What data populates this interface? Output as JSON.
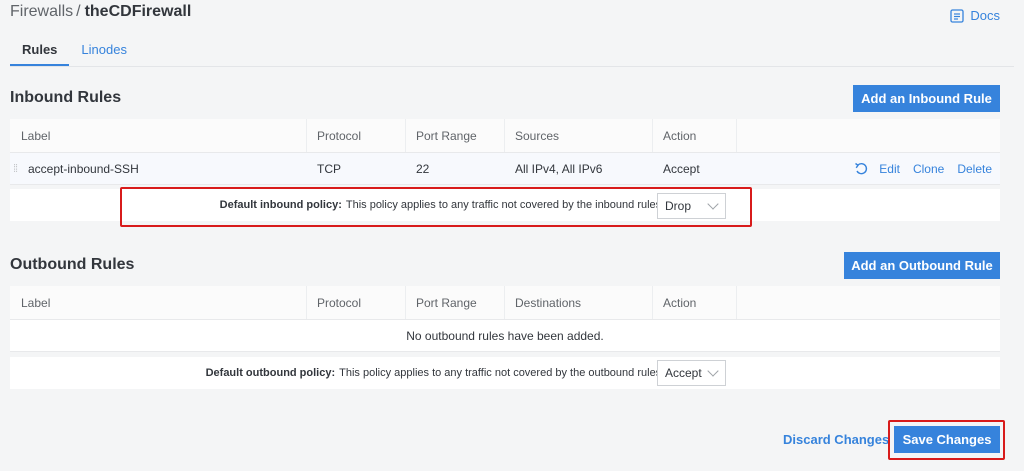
{
  "breadcrumb": {
    "parent": "Firewalls",
    "separator": "/",
    "current": "theCDFirewall"
  },
  "docs": {
    "label": "Docs",
    "icon": "docs-icon"
  },
  "tabs": [
    {
      "label": "Rules",
      "active": true
    },
    {
      "label": "Linodes",
      "active": false
    }
  ],
  "inbound": {
    "title": "Inbound Rules",
    "add_button": "Add an Inbound Rule",
    "columns": [
      "Label",
      "Protocol",
      "Port Range",
      "Sources",
      "Action"
    ],
    "rows": [
      {
        "label": "accept-inbound-SSH",
        "protocol": "TCP",
        "port_range": "22",
        "sources": "All IPv4, All IPv6",
        "action": "Accept"
      }
    ],
    "row_actions": [
      "Edit",
      "Clone",
      "Delete"
    ],
    "policy_label": "Default inbound policy:",
    "policy_text": "This policy applies to any traffic not covered by the inbound rules listed above.",
    "policy_value": "Drop"
  },
  "outbound": {
    "title": "Outbound Rules",
    "add_button": "Add an Outbound Rule",
    "columns": [
      "Label",
      "Protocol",
      "Port Range",
      "Destinations",
      "Action"
    ],
    "empty_text": "No outbound rules have been added.",
    "policy_label": "Default outbound policy:",
    "policy_text": "This policy applies to any traffic not covered by the outbound rules listed above.",
    "policy_value": "Accept"
  },
  "footer": {
    "discard": "Discard Changes",
    "save": "Save Changes"
  },
  "colors": {
    "accent": "#3683dc",
    "highlight": "#d81b1b",
    "background": "#f4f5f6"
  }
}
